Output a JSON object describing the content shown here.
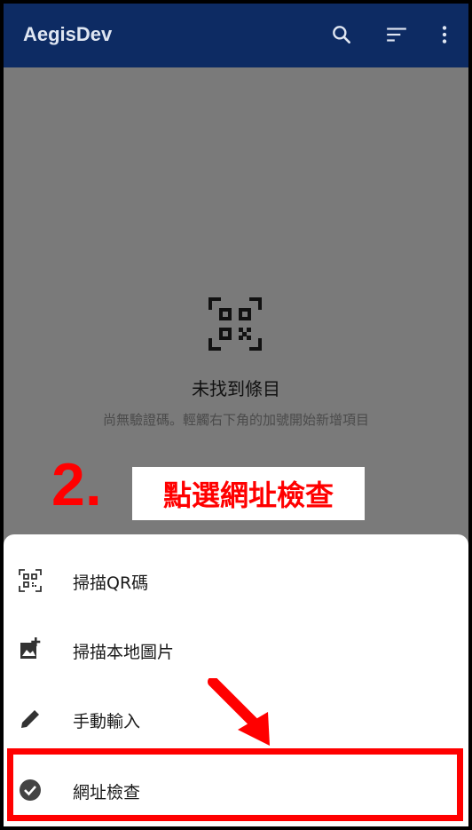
{
  "app_bar": {
    "title": "AegisDev",
    "icons": [
      "search-icon",
      "sort-icon",
      "more-vert-icon"
    ]
  },
  "empty_state": {
    "icon": "qr-code-icon",
    "title": "未找到條目",
    "subtitle": "尚無驗證碼。輕觸右下角的加號開始新增項目"
  },
  "annotation": {
    "step_number": "2.",
    "step_label": "點選網址檢查",
    "color": "#ff0000"
  },
  "bottom_sheet": {
    "items": [
      {
        "label": "掃描QR碼",
        "icon": "qr-scan-icon"
      },
      {
        "label": "掃描本地圖片",
        "icon": "add-photo-icon"
      },
      {
        "label": "手動輸入",
        "icon": "pencil-icon"
      },
      {
        "label": "網址檢查",
        "icon": "check-circle-icon"
      }
    ]
  },
  "colors": {
    "app_bar": "#0d2b63",
    "overlay": "#7a7a7a",
    "sheet": "#ffffff"
  }
}
